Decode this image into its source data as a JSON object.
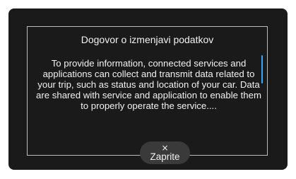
{
  "dialog": {
    "title": "Dogovor o izmenjavi podatkov",
    "body": "To provide information, connected services and applications can collect and transmit data related to your trip, such as status and location of your car. Data are shared with service and application to enable them to properly operate the service....",
    "close_icon": "close-icon",
    "close_label": "Zaprite"
  },
  "colors": {
    "screen_background": "#1a1a1a",
    "border": "#bdbdbd",
    "text": "#f2f2f2",
    "scrollbar": "#39a7f5",
    "button_background": "#3a3a3a"
  }
}
